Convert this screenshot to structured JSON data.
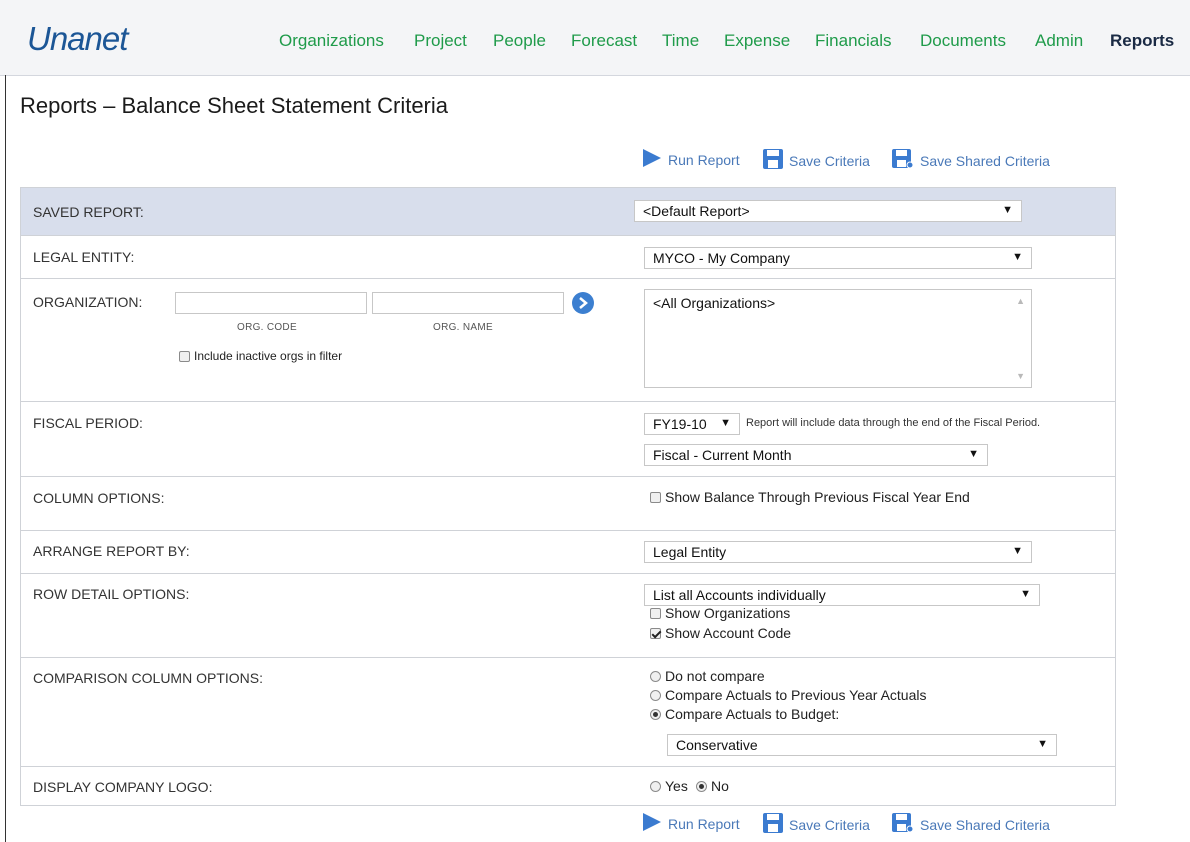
{
  "app": {
    "logo": "Unanet"
  },
  "nav": {
    "items": [
      {
        "label": "Organizations"
      },
      {
        "label": "Project"
      },
      {
        "label": "People"
      },
      {
        "label": "Forecast"
      },
      {
        "label": "Time"
      },
      {
        "label": "Expense"
      },
      {
        "label": "Financials"
      },
      {
        "label": "Documents"
      },
      {
        "label": "Admin"
      },
      {
        "label": "Reports",
        "active": true
      }
    ]
  },
  "page": {
    "title": "Reports – Balance Sheet Statement Criteria"
  },
  "actions": {
    "run_report": "Run Report",
    "save_criteria": "Save Criteria",
    "save_shared_criteria": "Save Shared Criteria"
  },
  "criteria": {
    "saved_report": {
      "label": "SAVED REPORT:",
      "value": "<Default Report>"
    },
    "legal_entity": {
      "label": "LEGAL ENTITY:",
      "value": "MYCO - My Company"
    },
    "organization": {
      "label": "ORGANIZATION:",
      "code_caption": "ORG. CODE",
      "name_caption": "ORG. NAME",
      "include_inactive": "Include inactive orgs in filter",
      "list_value": "<All Organizations>"
    },
    "fiscal_period": {
      "label": "FISCAL PERIOD:",
      "period": "FY19-10",
      "note": "Report will include data through the end of the Fiscal Period.",
      "range": "Fiscal - Current Month"
    },
    "column_options": {
      "label": "COLUMN OPTIONS:",
      "show_balance": "Show Balance Through Previous Fiscal Year End"
    },
    "arrange_by": {
      "label": "ARRANGE REPORT BY:",
      "value": "Legal Entity"
    },
    "row_detail": {
      "label": "ROW DETAIL OPTIONS:",
      "value": "List all Accounts individually",
      "show_orgs": "Show Organizations",
      "show_account_code": "Show Account Code"
    },
    "comparison": {
      "label": "COMPARISON COLUMN OPTIONS:",
      "opt1": "Do not compare",
      "opt2": "Compare Actuals to Previous Year Actuals",
      "opt3": "Compare Actuals to Budget:",
      "budget": "Conservative"
    },
    "logo": {
      "label": "DISPLAY COMPANY LOGO:",
      "yes": "Yes",
      "no": "No"
    }
  },
  "colors": {
    "nav_link": "#1f9b4a",
    "action_link": "#4a79b8",
    "header_row": "#d8deec",
    "logo": "#1c5696"
  },
  "icons": [
    "play-icon",
    "save-icon",
    "save-shared-icon",
    "arrow-right-icon",
    "caret-down-icon"
  ]
}
